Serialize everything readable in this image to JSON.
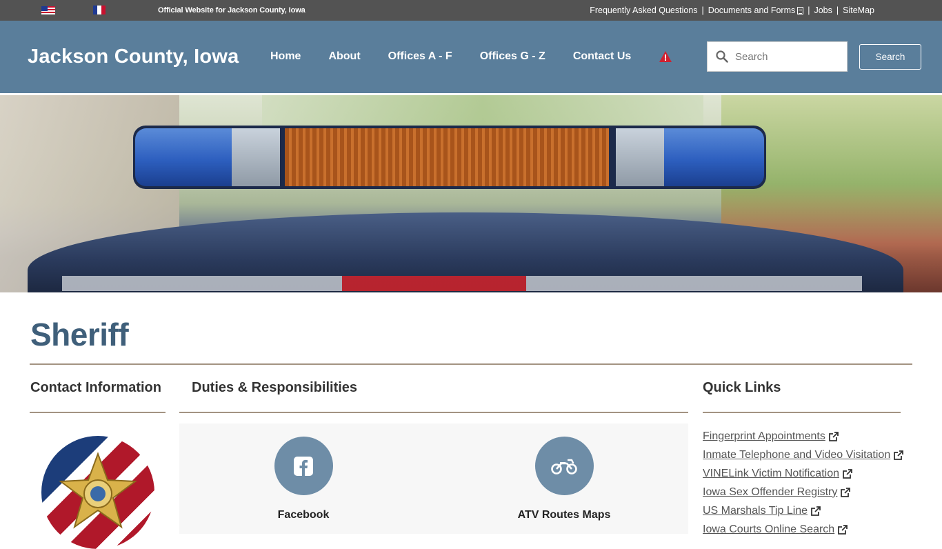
{
  "topbar": {
    "official_text": "Official Website for Jackson County, Iowa",
    "links": [
      "Frequently Asked Questions",
      "Documents and Forms",
      "Jobs",
      "SiteMap"
    ],
    "separator": "|"
  },
  "header": {
    "site_title": "Jackson County, Iowa",
    "nav": [
      "Home",
      "About",
      "Offices A - F",
      "Offices G - Z",
      "Contact Us"
    ],
    "search_placeholder": "Search",
    "search_button": "Search"
  },
  "page": {
    "title": "Sheriff"
  },
  "columns": {
    "contact_heading": "Contact Information",
    "duties_heading": "Duties & Responsibilities",
    "quick_links_heading": "Quick Links"
  },
  "duties": [
    {
      "label": "Facebook",
      "icon": "facebook-icon"
    },
    {
      "label": "ATV Routes Maps",
      "icon": "motorcycle-icon"
    }
  ],
  "quick_links": [
    "Fingerprint Appointments",
    "Inmate Telephone and Video Visitation",
    "VINELink Victim Notification",
    "Iowa Sex Offender Registry",
    "US Marshals Tip Line",
    "Iowa Courts Online Search"
  ],
  "colors": {
    "header_bg": "#5a7e9b",
    "topbar_bg": "#535353",
    "title_color": "#3f5f7a",
    "rule_color": "#a39382",
    "duty_circle": "#6e8da7"
  }
}
